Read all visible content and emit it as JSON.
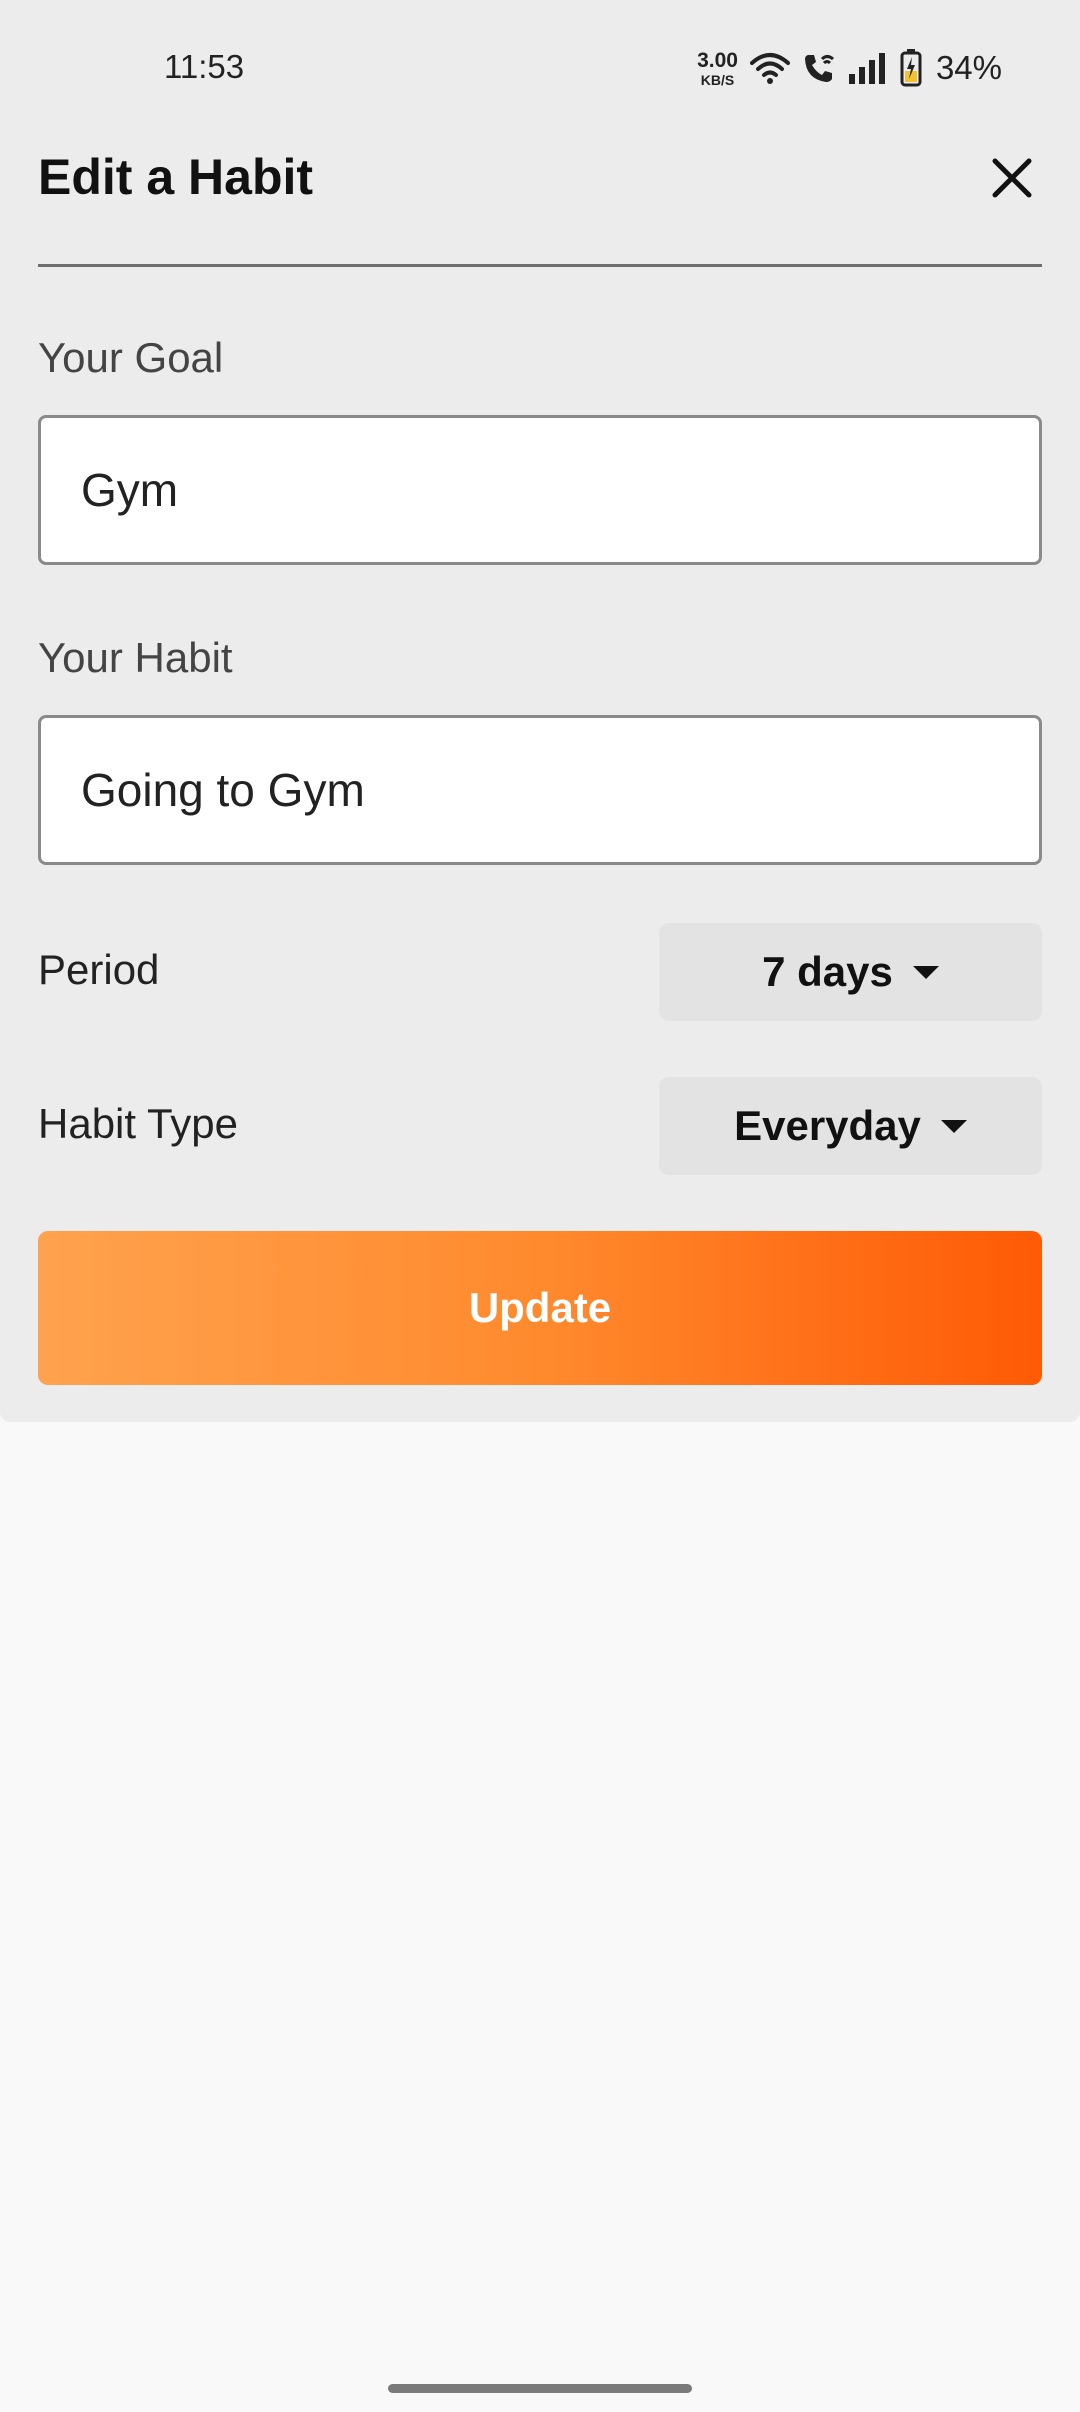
{
  "status_bar": {
    "time": "11:53",
    "net_speed_value": "3.00",
    "net_speed_unit": "KB/S",
    "battery_percent": "34%",
    "icons": [
      "wifi-icon",
      "wifi-calling-icon",
      "signal-icon",
      "battery-charging-icon"
    ]
  },
  "sheet": {
    "title": "Edit a Habit",
    "close_icon": "close-icon",
    "goal_label": "Your Goal",
    "goal_value": "Gym",
    "habit_label": "Your Habit",
    "habit_value": "Going to Gym",
    "period_label": "Period",
    "period_value": "7 days",
    "habit_type_label": "Habit Type",
    "habit_type_value": "Everyday",
    "update_label": "Update"
  },
  "colors": {
    "accent_start": "#ffa24e",
    "accent_end": "#ff5a05",
    "sheet_background": "#ececec",
    "page_background": "#f9f9f9"
  }
}
